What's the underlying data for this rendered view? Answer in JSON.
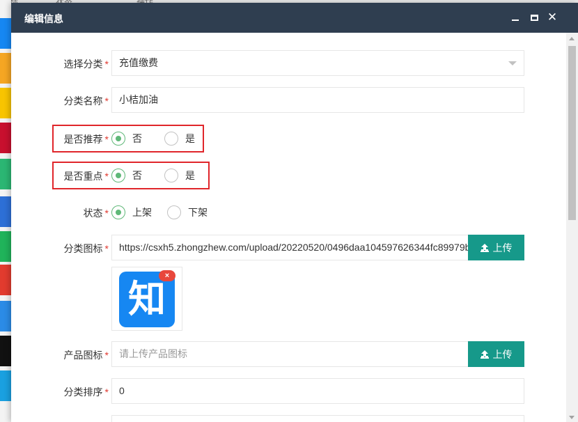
{
  "background": {
    "top_fragments": [
      "图标",
      "状态",
      "操作"
    ]
  },
  "modal": {
    "title": "编辑信息",
    "header_icons": [
      "minimize-icon",
      "maximize-icon",
      "close-icon"
    ]
  },
  "form": {
    "required_mark": "*",
    "category_select": {
      "label": "选择分类",
      "value": "充值缴费"
    },
    "category_name": {
      "label": "分类名称",
      "value": "小桔加油"
    },
    "recommend": {
      "label": "是否推荐",
      "options": [
        "否",
        "是"
      ],
      "selected": "否"
    },
    "key_point": {
      "label": "是否重点",
      "options": [
        "否",
        "是"
      ],
      "selected": "否"
    },
    "status": {
      "label": "状态",
      "options": [
        "上架",
        "下架"
      ],
      "selected": "上架"
    },
    "category_icon": {
      "label": "分类图标",
      "value": "https://csxh5.zhongzhew.com/upload/20220520/0496daa104597626344fc89979b",
      "upload_label": "上传",
      "preview_glyph": "知",
      "delete_badge": "×"
    },
    "product_icon": {
      "label": "产品图标",
      "placeholder": "请上传产品图标",
      "upload_label": "上传"
    },
    "sort_order": {
      "label": "分类排序",
      "value": "0"
    }
  },
  "colors": {
    "header_bg": "#2f3e50",
    "accent_green": "#5fb878",
    "upload_teal": "#16998a",
    "highlight_red": "#e0252a",
    "required_red": "#e0382f"
  }
}
